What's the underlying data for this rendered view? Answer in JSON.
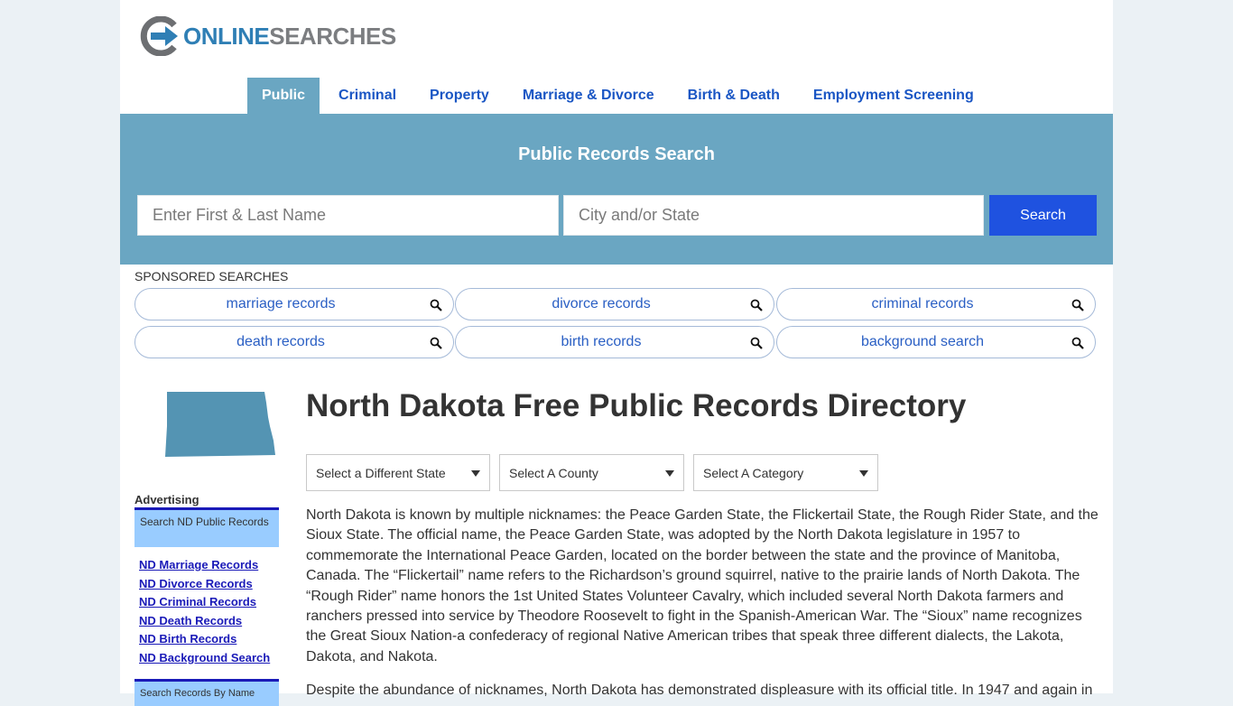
{
  "logo": {
    "part1": "ONLINE",
    "part2": "SEARCHES"
  },
  "nav": [
    {
      "label": "Public",
      "active": true
    },
    {
      "label": "Criminal",
      "active": false
    },
    {
      "label": "Property",
      "active": false
    },
    {
      "label": "Marriage & Divorce",
      "active": false
    },
    {
      "label": "Birth & Death",
      "active": false
    },
    {
      "label": "Employment Screening",
      "active": false
    }
  ],
  "search": {
    "title": "Public Records Search",
    "name_placeholder": "Enter First & Last Name",
    "location_placeholder": "City and/or State",
    "button_label": "Search"
  },
  "sponsored": {
    "label": "SPONSORED SEARCHES",
    "items": [
      "marriage records",
      "divorce records",
      "criminal records",
      "death records",
      "birth records",
      "background search"
    ]
  },
  "sidebar": {
    "advertising_label": "Advertising",
    "box1_title": "Search ND Public Records",
    "links": [
      "ND Marriage Records",
      "ND Divorce Records",
      "ND Criminal Records",
      "ND Death Records",
      "ND Birth Records",
      "ND Background Search"
    ],
    "box2_title": "Search Records By Name"
  },
  "main": {
    "title": "North Dakota Free Public Records Directory",
    "selects": [
      "Select a Different State",
      "Select A County",
      "Select A Category"
    ],
    "paragraph1": "North Dakota is known by multiple nicknames: the Peace Garden State, the Flickertail State, the Rough Rider State, and the Sioux State. The official name, the Peace Garden State, was adopted by the North Dakota legislature in 1957 to commemorate the International Peace Garden, located on the border between the state and the province of Manitoba, Canada. The “Flickertail” name refers to the Richardson’s ground squirrel, native to the prairie lands of North Dakota. The “Rough Rider” name honors the 1st United States Volunteer Cavalry, which included several North Dakota farmers and ranchers pressed into service by Theodore Roosevelt to fight in the Spanish-American War. The “Sioux” name recognizes the Great Sioux Nation-a confederacy of regional Native American tribes that speak three different dialects, the Lakota, Dakota, and Nakota.",
    "paragraph2": "Despite the abundance of nicknames, North Dakota has demonstrated displeasure with its official title. In 1947 and again in"
  },
  "colors": {
    "band": "#6aa6c2",
    "search_button": "#1f52e0",
    "nav_link": "#1a56c4",
    "state_map": "#5494b3",
    "sidebar_box": "#99ccff"
  }
}
